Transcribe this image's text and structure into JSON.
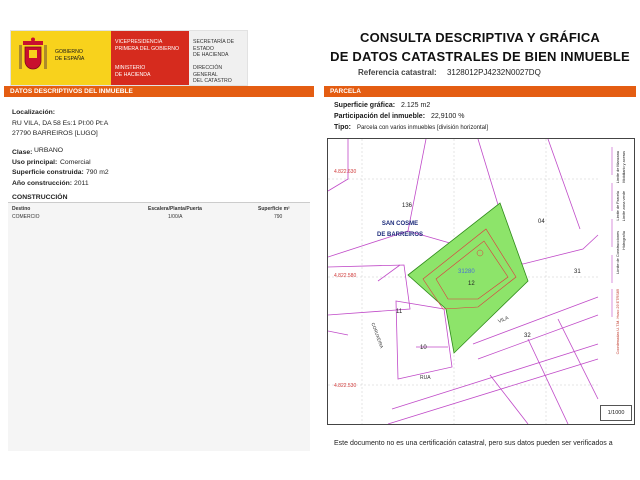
{
  "header": {
    "gobierno": "GOBIERNO\nDE ESPAÑA",
    "vicepresidencia": "VICEPRESIDENCIA\nPRIMERA DEL GOBIERNO",
    "ministerio": "MINISTERIO\nDE HACIENDA",
    "secretaria": "SECRETARÍA DE ESTADO\nDE HACIENDA",
    "direccion": "DIRECCIÓN GENERAL\nDEL CATASTRO",
    "title_line1": "CONSULTA DESCRIPTIVA Y GRÁFICA",
    "title_line2": "DE DATOS CATASTRALES DE BIEN INMUEBLE",
    "ref_label": "Referencia catastral:",
    "ref_value": "3128012PJ4232N0027DQ"
  },
  "left": {
    "section_title": "DATOS DESCRIPTIVOS DEL INMUEBLE",
    "localizacion_label": "Localización:",
    "localizacion_line1": "RU VILA, DA 58 Es:1 Pl:00 Pt:A",
    "localizacion_line2": "27790 BARREIROS [LUGO]",
    "clase_label": "Clase:",
    "clase_value": "URBANO",
    "uso_label": "Uso principal:",
    "uso_value": "Comercial",
    "sup_label": "Superficie construida:",
    "sup_value": "790 m2",
    "anio_label": "Año construcción:",
    "anio_value": "2011",
    "construccion_title": "CONSTRUCCIÓN",
    "table": {
      "headers": [
        "Destino",
        "Escalera/Planta/Puerta",
        "Superficie m²"
      ],
      "rows": [
        [
          "COMERCIO",
          "1/00/A",
          "790"
        ]
      ]
    }
  },
  "right": {
    "section_title": "PARCELA",
    "sup_grafica_label": "Superficie gráfica:",
    "sup_grafica_value": "2.125 m2",
    "participacion_label": "Participación del inmueble:",
    "participacion_value": "22,9100 %",
    "tipo_label": "Tipo:",
    "tipo_value": "Parcela con varios inmuebles [división horizontal]"
  },
  "map": {
    "coord_top": "4.822.630",
    "coord_mid": "4.822.580",
    "coord_low": "4.822.530",
    "parcel_136": "136",
    "parcel_04": "04",
    "parcel_12": "12",
    "parcel_11": "11",
    "parcel_10": "10",
    "parcel_31": "31",
    "parcel_32": "32",
    "plot_code": "31280",
    "place_line1": "SAN COSME",
    "place_line2": "DE BARREIROS",
    "street_rua": "RUA",
    "street_vila": "VILA",
    "street_side": "CORUXEIRA",
    "legend_1": "Límite de Manzana",
    "legend_2": "Límite de Parcela",
    "legend_3": "Límite de Construcciones",
    "legend_4": "Mobiliario y aceras",
    "legend_5": "Límite zona verde",
    "legend_6": "Hidrografía",
    "side_text": "Coordenadas U.T.M. Huso 29 ETRS89",
    "scale_label": "1/1000"
  },
  "footer": {
    "note": "Este documento no es una certificación catastral, pero sus datos pueden ser verificados a"
  },
  "colors": {
    "accent_orange": "#e45d12",
    "parcel_green": "#8de46a",
    "boundary_magenta": "#c04ac8"
  }
}
